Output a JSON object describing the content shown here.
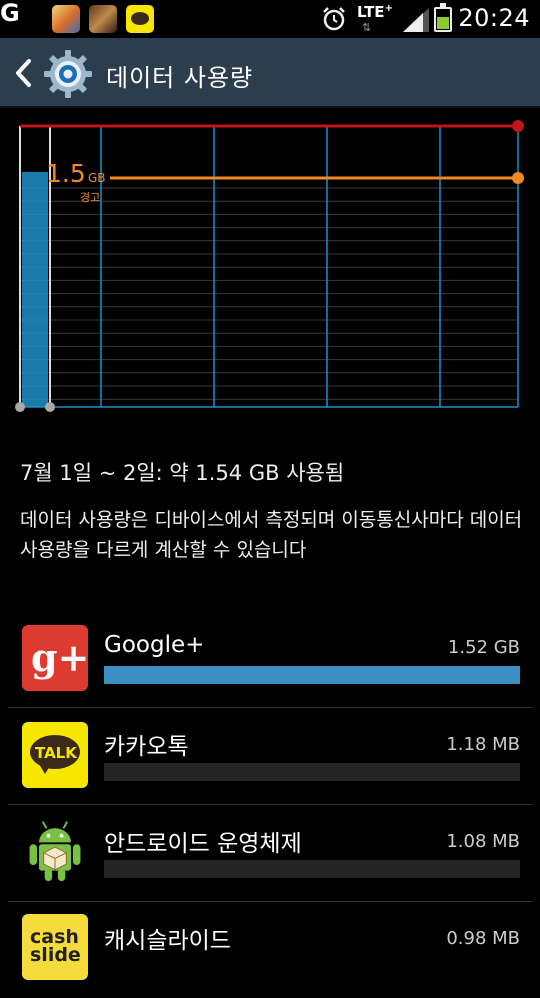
{
  "status_bar": {
    "time": "20:24",
    "network": "LTE",
    "network_sup": "+",
    "notification_icons": [
      "g-icon",
      "game-icon",
      "game-icon",
      "kakaotalk-icon"
    ],
    "g_label": "G",
    "talk_badge": "TALK",
    "battery_level": 0.55
  },
  "header": {
    "title": "데이터 사용량"
  },
  "chart_data": {
    "type": "area",
    "series": [
      {
        "values": [
          1.52,
          1.54
        ]
      }
    ],
    "limit_label_value": "1.5",
    "limit_label_unit": "GB",
    "warning_label": "경고",
    "warning_value": 1.5,
    "limit_line_color": "#c0151c",
    "warning_line_color": "#f08a24",
    "bar_color": "#1e90c8",
    "grid": true
  },
  "summary": {
    "range_text": "7월 1일 ~ 2일: 약 1.54 GB 사용됨",
    "note": "데이터 사용량은 디바이스에서 측정되며 이동통신사마다 데이터 사용량을 다르게 계산할 수 있습니다"
  },
  "apps": [
    {
      "name": "Google+",
      "size": "1.52 GB",
      "fraction": 1.0,
      "icon": "google-plus-icon",
      "icon_text": "g+"
    },
    {
      "name": "카카오톡",
      "size": "1.18 MB",
      "fraction": 0.0,
      "icon": "kakaotalk-icon",
      "icon_text": "TALK"
    },
    {
      "name": "안드로이드 운영체제",
      "size": "1.08 MB",
      "fraction": 0.0,
      "icon": "android-icon",
      "icon_text": ""
    },
    {
      "name": "캐시슬라이드",
      "size": "0.98 MB",
      "fraction": 0.0,
      "icon": "cashslide-icon",
      "icon_text": "cash slide"
    }
  ]
}
